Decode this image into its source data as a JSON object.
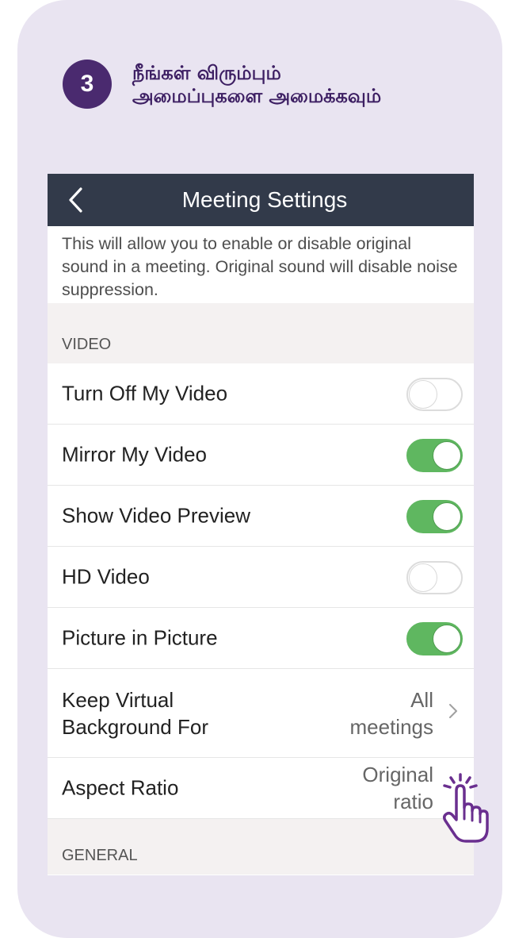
{
  "step": {
    "number": "3",
    "line1": "நீங்கள் விரும்பும்",
    "line2": "அமைப்புகளை அமைக்கவும்"
  },
  "nav": {
    "back_icon": "chevron-left-icon",
    "title": "Meeting Settings"
  },
  "description": "This will allow you to enable or disable original sound in a meeting. Original sound will disable noise suppression.",
  "video_section": {
    "header": "VIDEO",
    "rows": [
      {
        "label": "Turn Off My Video",
        "enabled": false
      },
      {
        "label": "Mirror My Video",
        "enabled": true
      },
      {
        "label": "Show Video Preview",
        "enabled": true
      },
      {
        "label": "HD Video",
        "enabled": false
      },
      {
        "label": "Picture in Picture",
        "enabled": true
      }
    ],
    "virtual_bg": {
      "label_line1": "Keep Virtual",
      "label_line2": "Background For",
      "value_line1": "All",
      "value_line2": "meetings",
      "chevron_icon": "chevron-right-icon"
    },
    "aspect_ratio": {
      "label": "Aspect Ratio",
      "value_line1": "Original",
      "value_line2": "ratio"
    }
  },
  "general_section": {
    "header": "GENERAL"
  },
  "colors": {
    "card_bg": "#e9e4f1",
    "badge": "#4a2a6f",
    "nav_bar": "#323a4a",
    "toggle_on": "#5fb760",
    "hand_icon": "#6a2f8f"
  },
  "pointer_icon": "tap-hand-icon"
}
